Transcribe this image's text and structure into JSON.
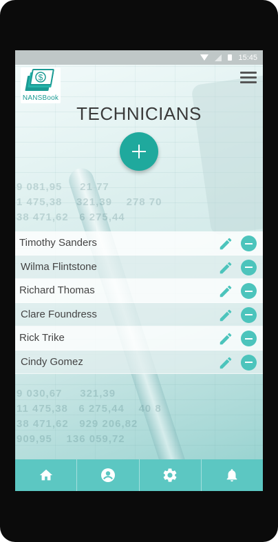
{
  "status_bar": {
    "time": "15:45"
  },
  "app": {
    "logo_text": "NANSBook",
    "logo_symbol": "$"
  },
  "header": {
    "title": "TECHNICIANS"
  },
  "technicians": [
    {
      "name": "Timothy Sanders"
    },
    {
      "name": "Wilma Flintstone"
    },
    {
      "name": "Richard Thomas"
    },
    {
      "name": "Clare Foundress"
    },
    {
      "name": "Rick Trike"
    },
    {
      "name": "Cindy Gomez"
    }
  ],
  "bottom_nav": [
    {
      "icon": "home-icon"
    },
    {
      "icon": "account-icon"
    },
    {
      "icon": "settings-icon"
    },
    {
      "icon": "notifications-icon"
    }
  ],
  "colors": {
    "accent": "#1fa99d",
    "nav_bg": "#5cc7c2",
    "icon_teal": "#4cc4bc"
  }
}
